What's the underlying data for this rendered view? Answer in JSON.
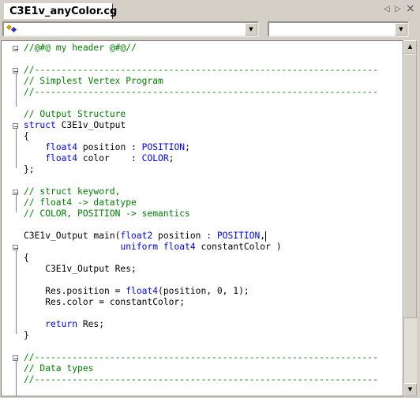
{
  "tab": {
    "label": "C3E1v_anyColor.cg"
  },
  "tabnav": {
    "left": "◁",
    "right": "▷",
    "close": "×"
  },
  "combos": {
    "left_value": "",
    "right_value": ""
  },
  "code_lines": [
    [
      {
        "t": "//@#@ my header @#@//",
        "c": "c"
      }
    ],
    [],
    [
      {
        "t": "//----------------------------------------------------------------",
        "c": "c"
      }
    ],
    [
      {
        "t": "// Simplest Vertex Program",
        "c": "c"
      }
    ],
    [
      {
        "t": "//----------------------------------------------------------------",
        "c": "c"
      }
    ],
    [],
    [
      {
        "t": "// Output Structure",
        "c": "c"
      }
    ],
    [
      {
        "t": "struct",
        "c": "k"
      },
      {
        "t": " C3E1v_Output",
        "c": ""
      }
    ],
    [
      {
        "t": "{",
        "c": ""
      }
    ],
    [
      {
        "t": "    ",
        "c": ""
      },
      {
        "t": "float4",
        "c": "k"
      },
      {
        "t": " position : ",
        "c": ""
      },
      {
        "t": "POSITION",
        "c": "k"
      },
      {
        "t": ";",
        "c": ""
      }
    ],
    [
      {
        "t": "    ",
        "c": ""
      },
      {
        "t": "float4",
        "c": "k"
      },
      {
        "t": " color    : ",
        "c": ""
      },
      {
        "t": "COLOR",
        "c": "k"
      },
      {
        "t": ";",
        "c": ""
      }
    ],
    [
      {
        "t": "};",
        "c": ""
      }
    ],
    [],
    [
      {
        "t": "// struct keyword,",
        "c": "c"
      }
    ],
    [
      {
        "t": "// float4 -> datatype",
        "c": "c"
      }
    ],
    [
      {
        "t": "// COLOR, POSITION -> semantics",
        "c": "c"
      }
    ],
    [],
    [
      {
        "t": "C3E1v_Output main(",
        "c": ""
      },
      {
        "t": "float2",
        "c": "k"
      },
      {
        "t": " position : ",
        "c": ""
      },
      {
        "t": "POSITION",
        "c": "k"
      },
      {
        "t": ",",
        "c": ""
      }
    ],
    [
      {
        "t": "                  ",
        "c": ""
      },
      {
        "t": "uniform",
        "c": "k"
      },
      {
        "t": " ",
        "c": ""
      },
      {
        "t": "float4",
        "c": "k"
      },
      {
        "t": " constantColor )",
        "c": ""
      }
    ],
    [
      {
        "t": "{",
        "c": ""
      }
    ],
    [
      {
        "t": "    C3E1v_Output Res;",
        "c": ""
      }
    ],
    [],
    [
      {
        "t": "    Res.position = ",
        "c": ""
      },
      {
        "t": "float4",
        "c": "k"
      },
      {
        "t": "(position, 0, 1);",
        "c": ""
      }
    ],
    [
      {
        "t": "    Res.color = constantColor;",
        "c": ""
      }
    ],
    [],
    [
      {
        "t": "    ",
        "c": ""
      },
      {
        "t": "return",
        "c": "k"
      },
      {
        "t": " Res;",
        "c": ""
      }
    ],
    [
      {
        "t": "}",
        "c": ""
      }
    ],
    [],
    [
      {
        "t": "//----------------------------------------------------------------",
        "c": "c"
      }
    ],
    [
      {
        "t": "// Data types",
        "c": "c"
      }
    ],
    [
      {
        "t": "//----------------------------------------------------------------",
        "c": "c"
      }
    ]
  ],
  "colors": {
    "comment": "#008000",
    "keyword": "#0000ff",
    "text": "#000000",
    "chrome": "#d4d0c8"
  }
}
